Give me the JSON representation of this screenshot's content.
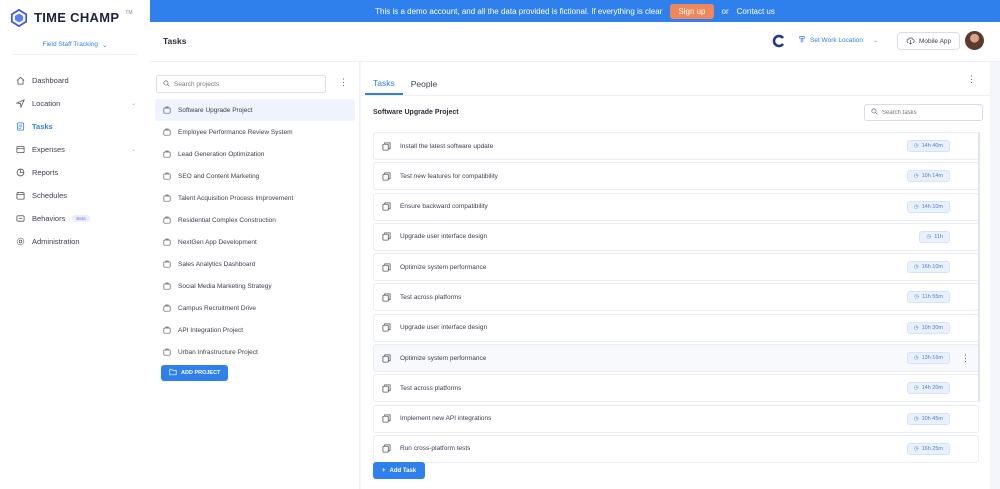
{
  "banner": {
    "message": "This is a demo account, and all the data provided is fictional. If everything is clear",
    "signup_label": "Sign up",
    "or_text": "or",
    "contact_label": "Contact us"
  },
  "brand": {
    "name": "TIME CHAMP",
    "trademark": "TM",
    "accent": "#2f80ed"
  },
  "sidebar": {
    "org_selector": "Field Staff Tracking",
    "items": [
      {
        "label": "Dashboard",
        "icon": "home-icon"
      },
      {
        "label": "Location",
        "icon": "location-arrow-icon",
        "expandable": true
      },
      {
        "label": "Tasks",
        "icon": "tasks-icon",
        "active": true
      },
      {
        "label": "Expenses",
        "icon": "expenses-icon",
        "expandable": true
      },
      {
        "label": "Reports",
        "icon": "reports-icon"
      },
      {
        "label": "Schedules",
        "icon": "calendar-icon"
      },
      {
        "label": "Behaviors",
        "icon": "behaviors-icon",
        "badge": "Beta"
      },
      {
        "label": "Administration",
        "icon": "gear-icon"
      }
    ]
  },
  "header": {
    "title": "Tasks",
    "work_location": "Set Work Location",
    "mobile_app": "Mobile App"
  },
  "projects": {
    "search_placeholder": "Search projects",
    "items": [
      "Software Upgrade Project",
      "Employee Performance Review System",
      "Lead Generation Optimization",
      "SEO and Content Marketing",
      "Talent Acquisition Process Improvement",
      "Residential Complex Construction",
      "NextGen App Development",
      "Sales Analytics Dashboard",
      "Social Media Marketing Strategy",
      "Campus Recruitment Drive",
      "API Integration Project",
      "Urban Infrastructure Project"
    ],
    "add_label": "ADD PROJECT"
  },
  "tasks": {
    "tabs": [
      "Tasks",
      "People"
    ],
    "active_tab": "Tasks",
    "section_title": "Software Upgrade Project",
    "search_placeholder": "Search tasks",
    "items": [
      {
        "name": "Install the latest software update",
        "time": "14h 40m"
      },
      {
        "name": "Test new features for compatibility",
        "time": "10h 14m"
      },
      {
        "name": "Ensure backward compatibility",
        "time": "14h 10m"
      },
      {
        "name": "Upgrade user interface design",
        "time": "11h"
      },
      {
        "name": "Optimize system performance",
        "time": "16h 10m"
      },
      {
        "name": "Test across platforms",
        "time": "11h 55m"
      },
      {
        "name": "Upgrade user interface design",
        "time": "10h 30m"
      },
      {
        "name": "Optimize system performance",
        "time": "13h 16m"
      },
      {
        "name": "Test across platforms",
        "time": "14h 20m"
      },
      {
        "name": "Implement new API integrations",
        "time": "10h 45m"
      },
      {
        "name": "Run cross-platform tests",
        "time": "16h 25m"
      }
    ],
    "add_label": "Add Task"
  }
}
